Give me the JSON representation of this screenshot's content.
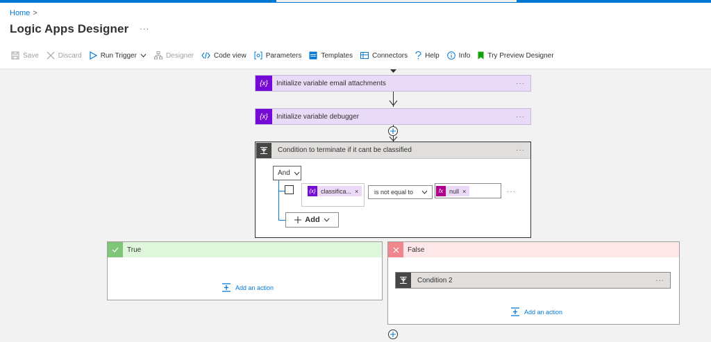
{
  "breadcrumb": {
    "home": "Home",
    "separator": ">"
  },
  "page": {
    "title": "Logic Apps Designer",
    "more": "···"
  },
  "toolbar": {
    "save": "Save",
    "discard": "Discard",
    "run_trigger": "Run Trigger",
    "designer": "Designer",
    "code_view": "Code view",
    "parameters": "Parameters",
    "templates": "Templates",
    "connectors": "Connectors",
    "help": "Help",
    "info": "Info",
    "try_preview": "Try Preview Designer"
  },
  "colors": {
    "accent": "#0078d4",
    "variable": "#770bd6",
    "true_header": "#dff6dd",
    "false_header": "#fde7e9"
  },
  "steps": [
    {
      "label": "Initialize variable email attachments",
      "badge": "{x}",
      "more": "···"
    },
    {
      "label": "Initialize variable debugger",
      "badge": "{x}",
      "more": "···"
    }
  ],
  "condition": {
    "title": "Condition to terminate if it cant be classified",
    "more": "···",
    "group_operator": "And",
    "row": {
      "left_token": "classifica...",
      "left_badge": "{x}",
      "operator": "is not equal to",
      "right_token": "null",
      "right_badge": "fx",
      "remove": "×",
      "more": "···"
    },
    "add_label": "Add"
  },
  "true_branch": {
    "label": "True",
    "add_action": "Add an action"
  },
  "false_branch": {
    "label": "False",
    "nested": {
      "label": "Condition 2",
      "more": "···"
    },
    "add_action": "Add an action"
  }
}
